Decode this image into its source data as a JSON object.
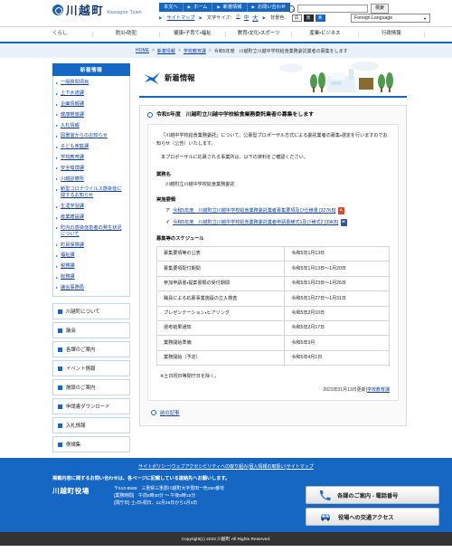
{
  "header": {
    "logo_jp": "川越町",
    "logo_en": "Kawagoe Town",
    "top_links": [
      "本文へ",
      "ホーム",
      "新着情報",
      "お問い合わせ"
    ],
    "sitemap": "サイトマップ",
    "textsize_label": "文字サイズ:",
    "textsize_options": [
      "小",
      "中",
      "大"
    ],
    "bgcolor_label": "背景色",
    "bgcolor_options": [
      "白",
      "黒",
      "青"
    ],
    "search_placeholder": "",
    "search_button": "検索",
    "language_select": "Foreign Language"
  },
  "gnav": {
    "items": [
      "くらし",
      "防災・防犯",
      "健康・子育て・福祉",
      "教育・文化・スポーツ",
      "産業・ビジネス",
      "行政情報"
    ]
  },
  "breadcrumb": {
    "items": [
      "HOME",
      "新着情報",
      "学校教育課"
    ],
    "current": "令和5年度　川越町立川越中学校給食業務委託業者の募集をします"
  },
  "sidebar": {
    "heading": "新着情報",
    "items": [
      "一般質問項目",
      "上下水道課",
      "企画情報課",
      "健康推進課",
      "入札情報",
      "図書室からのお知らせ",
      "子ども家庭課",
      "学校教育課",
      "安全環境課",
      "川越診療所",
      "新型コロナウイルス感染症に関するお知らせ",
      "生涯学習課",
      "産業建設課",
      "町内の感染症患者の発生状況について",
      "町民保険課",
      "福祉課",
      "税務課",
      "総務課",
      "議会事務局"
    ],
    "blocks": [
      "川越町について",
      "議会",
      "各課のご案内",
      "イベント情報",
      "施設のご案内",
      "申請書ダウンロード",
      "入札情報",
      "例規集"
    ]
  },
  "page": {
    "banner_title": "新着情報",
    "article_title": "令和5年度　川越町立川越中学校給食業務委託業者の募集をします",
    "paragraph1": "「川越中学校給食業務委託」について、公募型プロポーザル方式による委託業者の募集・選定を行いますのでお知らせ（公告）いたします。",
    "paragraph2": "本プロポーザルに応募される事業所は、以下の資料をご確認ください。",
    "section_gyomu_label": "業務名",
    "gyomu_value": "川越町立川越中学校給食業務委託",
    "section_youryou_label": "実施要領",
    "documents": [
      {
        "index": "ア",
        "label": "令和5年度　川越町立川越中学校給食業務委託業者募集要項及び仕様書 [327KB]",
        "icon": "pdf-icon"
      },
      {
        "index": "イ",
        "label": "令和5年度　川越町立川越中学校給食業務委託業者申請書様式1及び様式2 [39KB]",
        "icon": "word-icon"
      }
    ],
    "schedule_label": "募集等のスケジュール",
    "schedule": [
      [
        "募集要項等の公表",
        "令和5年1月13日"
      ],
      [
        "募集要項配付期間",
        "令和5年1月13日～1月20日"
      ],
      [
        "参加申請書・提案書類の受付期間",
        "令和5年1月23日～1月26日"
      ],
      [
        "職員による応募事業施設の立入検査",
        "令和5年1月27日～1月31日"
      ],
      [
        "プレゼンテーション・ヒアリング",
        "令和5年2月10日"
      ],
      [
        "選考結果通知",
        "令和5年2月17日"
      ],
      [
        "業務開始準備",
        "令和5年3月"
      ],
      [
        "業務開始（予定）",
        "令和5年4月1日"
      ]
    ],
    "note": "※土日祝日等閉庁日を除く。",
    "updated_text": "2023年01月13日更新",
    "updated_divider": "|",
    "updated_dept": "学校教育課",
    "prev_link": "前の記事"
  },
  "footer": {
    "links": [
      "サイトポリシー",
      "ウェブアクセシビリティへの取り組み",
      "個人情報の取扱い",
      "サイトマップ"
    ],
    "message": "掲載内容に関するお問い合わせは、各ページに記載している連絡先へお願いします。",
    "org": "川越町役場",
    "address": "〒510-8588　三重県三重郡川越町大字豊田一色280番地",
    "hours": "[業務時間]　午前8時30分 ～ 午後5時15分",
    "closed": "[閉庁日] 土・日・祝日、12月29日から1月3日",
    "buttons": [
      {
        "label": "各課のご案内 - 電話番号",
        "icon": "phone-icon"
      },
      {
        "label": "役場への交通アクセス",
        "icon": "car-icon"
      }
    ],
    "copyright": "Copyright(c) 2023 川越町 All Rights Reserved."
  }
}
